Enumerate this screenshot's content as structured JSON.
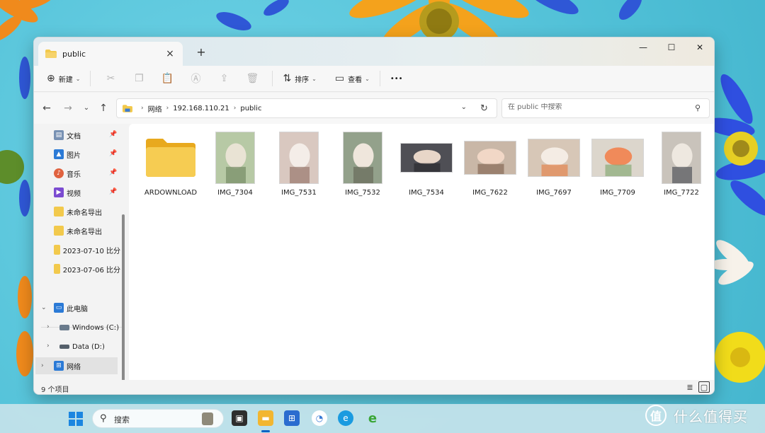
{
  "window": {
    "tab_title": "public",
    "new_tab": "+",
    "controls": {
      "minimize": "—",
      "maximize": "☐",
      "close": "✕"
    }
  },
  "toolbar": {
    "new_label": "新建",
    "sort_label": "排序",
    "view_label": "查看",
    "more_label": "•••"
  },
  "address": {
    "crumbs": [
      "网络",
      "192.168.110.21",
      "public"
    ],
    "search_placeholder": "在 public 中搜索"
  },
  "sidebar": {
    "quick": [
      {
        "label": "文档",
        "icon": "document-icon",
        "color": "#6b8bb3"
      },
      {
        "label": "图片",
        "icon": "pictures-icon",
        "color": "#2b7ad6"
      },
      {
        "label": "音乐",
        "icon": "music-icon",
        "color": "#e0623f"
      },
      {
        "label": "视频",
        "icon": "video-icon",
        "color": "#7b4bd1"
      },
      {
        "label": "未命名导出",
        "icon": "folder-icon",
        "color": "#f2c94c"
      },
      {
        "label": "未命名导出",
        "icon": "folder-icon",
        "color": "#f2c94c"
      },
      {
        "label": "2023-07-10 比分",
        "icon": "folder-icon",
        "color": "#f2c94c"
      },
      {
        "label": "2023-07-06 比分",
        "icon": "folder-icon",
        "color": "#f2c94c"
      }
    ],
    "this_pc": "此电脑",
    "drives": [
      "Windows (C:)",
      "Data (D:)"
    ],
    "network": "网络"
  },
  "files": [
    {
      "name": "ARDOWNLOAD",
      "kind": "folder"
    },
    {
      "name": "IMG_7304",
      "kind": "image",
      "tone": [
        "#b7c9a5",
        "#e9e3d4",
        "#7a8f6a"
      ]
    },
    {
      "name": "IMG_7531",
      "kind": "image",
      "tone": [
        "#d9c8c0",
        "#f4ede8",
        "#9c7d73"
      ]
    },
    {
      "name": "IMG_7532",
      "kind": "image",
      "tone": [
        "#93a18b",
        "#efe6dc",
        "#6b6f5d"
      ]
    },
    {
      "name": "IMG_7534",
      "kind": "image",
      "tone": [
        "#4f4f55",
        "#e8d6c8",
        "#2e2e33"
      ]
    },
    {
      "name": "IMG_7622",
      "kind": "image",
      "tone": [
        "#c9b7a7",
        "#f1d7c6",
        "#8b6f5c"
      ]
    },
    {
      "name": "IMG_7697",
      "kind": "image",
      "tone": [
        "#d7c7b7",
        "#f4ece4",
        "#e38a55"
      ]
    },
    {
      "name": "IMG_7709",
      "kind": "image",
      "tone": [
        "#dcd6cc",
        "#f08a5a",
        "#8fae7d"
      ]
    },
    {
      "name": "IMG_7722",
      "kind": "image",
      "tone": [
        "#c9c3bb",
        "#eee8e0",
        "#5a5c62"
      ]
    }
  ],
  "status": {
    "count_text": "9 个项目"
  },
  "taskbar": {
    "search_label": "搜索",
    "apps": [
      {
        "name": "task-view",
        "color": "#2d2d2d"
      },
      {
        "name": "file-explorer",
        "color": "#f2b630"
      },
      {
        "name": "microsoft-store",
        "color": "#2b6ccf"
      },
      {
        "name": "app-swirl",
        "color": "#3a7bd5"
      },
      {
        "name": "edge",
        "color": "#1a9be0"
      },
      {
        "name": "ie-browser",
        "color": "#3aa637"
      }
    ]
  },
  "watermark": {
    "logo": "值",
    "text": "什么值得买"
  }
}
